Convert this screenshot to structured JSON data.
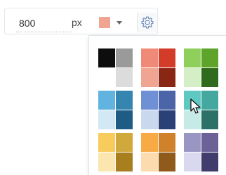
{
  "toolbar": {
    "size_value": "800",
    "unit": "px",
    "selected_color": "#f0a592",
    "settings_icon": "gear-icon"
  },
  "palette": {
    "groups": [
      {
        "name": "grayscale",
        "colors": [
          "#0d0d0d",
          "#9a9a9a",
          "#ffffff",
          "#dcdcdc"
        ]
      },
      {
        "name": "red",
        "colors": [
          "#f08a78",
          "#d43c2a",
          "#f0a592",
          "#8a2614"
        ]
      },
      {
        "name": "green",
        "colors": [
          "#8fd05c",
          "#5fa42a",
          "#d6eec6",
          "#306a1c"
        ]
      },
      {
        "name": "light-blue",
        "colors": [
          "#62b4e0",
          "#3684b0",
          "#d2e8f4",
          "#1e5c86"
        ]
      },
      {
        "name": "blue",
        "colors": [
          "#6f90d4",
          "#4c64a8",
          "#cad8ee",
          "#2c4078"
        ]
      },
      {
        "name": "teal",
        "colors": [
          "#5ec8c2",
          "#44a8a0",
          "#c6eae6",
          "#2c7068"
        ]
      },
      {
        "name": "yellow",
        "colors": [
          "#f8cc5c",
          "#d0a83c",
          "#fbe6b0",
          "#a87e1e"
        ]
      },
      {
        "name": "orange",
        "colors": [
          "#f8aa44",
          "#d0822a",
          "#fcdcae",
          "#905a1a"
        ]
      },
      {
        "name": "purple",
        "colors": [
          "#9a96c4",
          "#6c6298",
          "#dad8ee",
          "#403c6c"
        ]
      }
    ]
  }
}
